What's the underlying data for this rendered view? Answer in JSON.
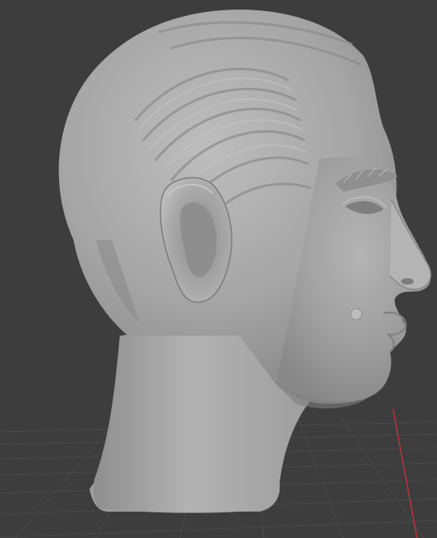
{
  "viewport": {
    "background_color": "#3d3d3d",
    "grid_line_color": "#4a4a4a",
    "x_axis_color": "#b5353f",
    "model_color": "#a8a8a8",
    "model": "sculpted-head-mesh",
    "view": "right-side-profile",
    "shading": "solid"
  }
}
